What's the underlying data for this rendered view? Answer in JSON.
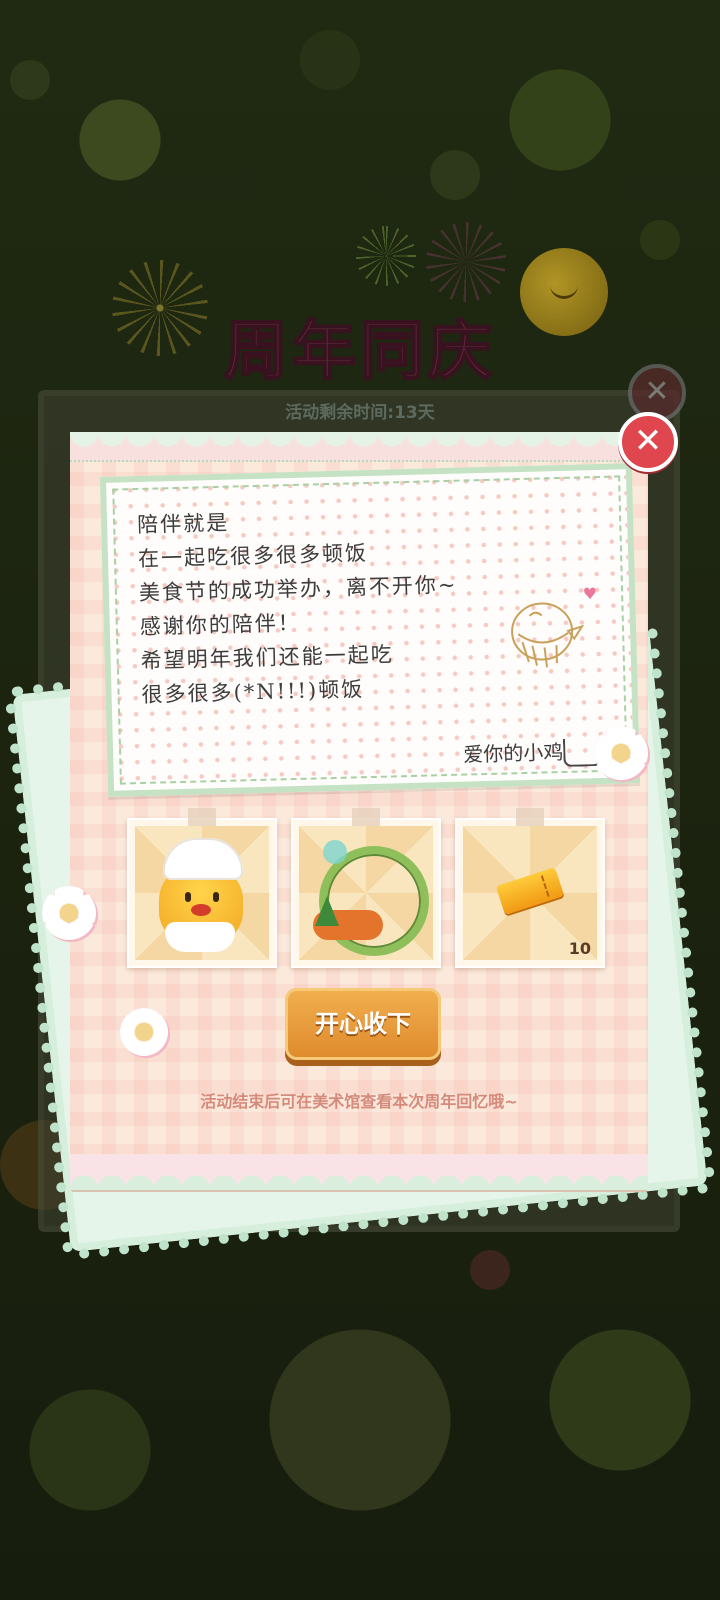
{
  "background": {
    "banner_title": "周年同庆",
    "banner_subtitle": "活动剩余时间:13天"
  },
  "letter": {
    "lines": [
      "陪伴就是",
      "在一起吃很多很多顿饭",
      "美食节的成功举办，离不开你~",
      "感谢你的陪伴！",
      "希望明年我们还能一起吃",
      "很多很多(*N!!!)顿饭"
    ],
    "signature": "爱你的小鸡"
  },
  "rewards": [
    {
      "icon": "chef-chick-avatar-icon",
      "count": ""
    },
    {
      "icon": "avatar-frame-icon",
      "count": ""
    },
    {
      "icon": "ticket-icon",
      "count": "10"
    }
  ],
  "buttons": {
    "confirm_label": "开心收下",
    "close_label": "✕"
  },
  "footer_hint": "活动结束后可在美术馆查看本次周年回忆哦~",
  "colors": {
    "close_red": "#e0464e",
    "confirm_orange": "#de8a2c",
    "note_border_green": "#c5e3c4",
    "hint_pink": "#d58b7c"
  }
}
